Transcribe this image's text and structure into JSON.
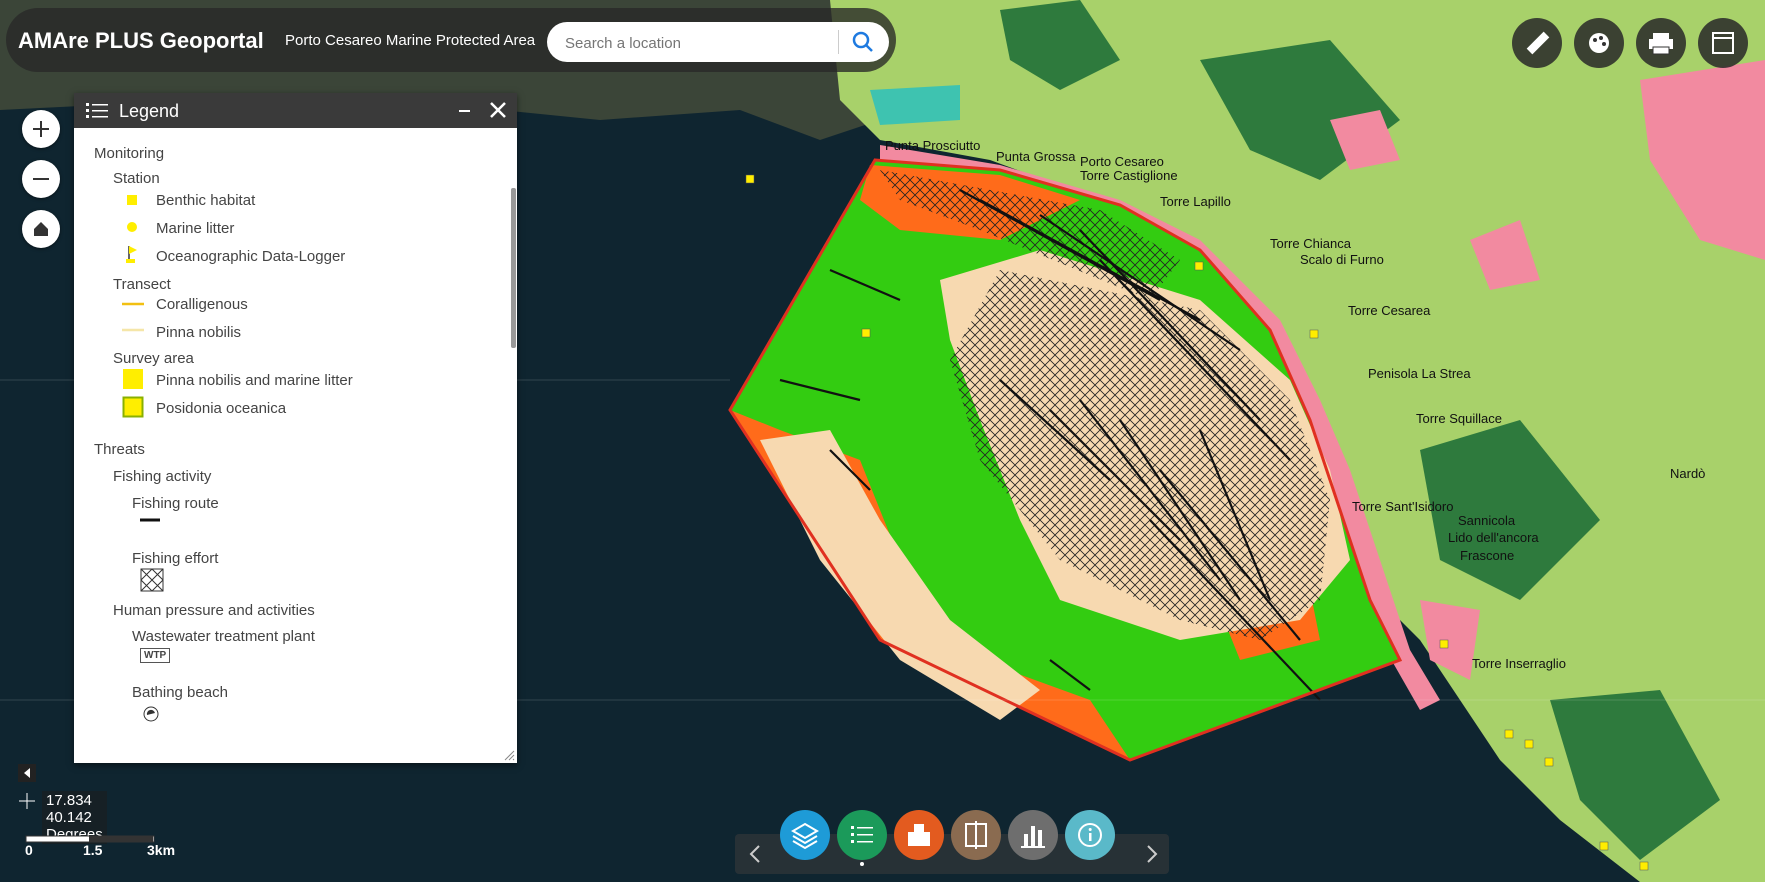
{
  "header": {
    "title": "AMAre PLUS Geoportal",
    "subtitle": "Porto Cesareo Marine Protected Area",
    "search_placeholder": "Search a location"
  },
  "legend": {
    "title": "Legend",
    "sections": [
      {
        "label": "Monitoring"
      },
      {
        "label": "Station"
      },
      {
        "label": "Benthic habitat"
      },
      {
        "label": "Marine litter"
      },
      {
        "label": "Oceanographic Data-Logger"
      },
      {
        "label": "Transect"
      },
      {
        "label": "Coralligenous"
      },
      {
        "label": "Pinna nobilis"
      },
      {
        "label": "Survey area"
      },
      {
        "label": "Pinna nobilis and marine litter"
      },
      {
        "label": "Posidonia oceanica"
      },
      {
        "label": "Threats"
      },
      {
        "label": "Fishing activity"
      },
      {
        "label": "Fishing route"
      },
      {
        "label": "Fishing effort"
      },
      {
        "label": "Human pressure and activities"
      },
      {
        "label": "Wastewater treatment plant"
      },
      {
        "label": "WTP"
      },
      {
        "label": "Bathing beach"
      }
    ]
  },
  "map": {
    "places": [
      "Punta Prosciutto",
      "Punta Grossa",
      "Porto Cesareo",
      "Torre Castiglione",
      "Torre Lapillo",
      "Torre Chianca",
      "Scalo di Furno",
      "Torre Cesarea",
      "Penisola La Strea",
      "Torre Squillace",
      "Torre Sant'Isidoro",
      "Sannicola",
      "Lido dell'ancora",
      "Frascone",
      "Torre Inserraglio",
      "Nardò"
    ],
    "coordinates": "17.834 40.142 Degrees",
    "scale_labels": [
      "0",
      "1.5",
      "3km"
    ]
  },
  "colors": {
    "sea": "#0f2530",
    "land": "#a8d16a",
    "seagrass": "#33cc11",
    "sand": "#f7d9b0",
    "rock": "#ff6b1a",
    "boundary": "#e03020",
    "urban": "#f28aa0"
  },
  "toolbar": {
    "icons": [
      "ruler-icon",
      "palette-icon",
      "print-icon",
      "window-icon"
    ],
    "dock": [
      "layers-icon",
      "legend-icon",
      "basemap-icon",
      "compare-icon",
      "chart-icon",
      "info-icon"
    ]
  }
}
